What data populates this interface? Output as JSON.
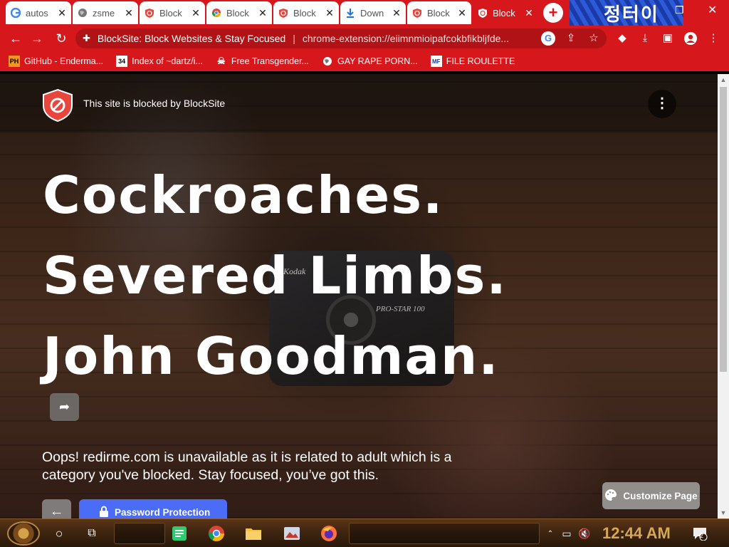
{
  "tabs": [
    {
      "title": "autos",
      "icon": "google-icon",
      "active": false
    },
    {
      "title": "zsme",
      "icon": "globe-icon",
      "active": false
    },
    {
      "title": "Block",
      "icon": "blocksite-shield-icon",
      "active": false
    },
    {
      "title": "Block",
      "icon": "chrome-icon",
      "active": false
    },
    {
      "title": "Block",
      "icon": "blocksite-shield-icon",
      "active": false
    },
    {
      "title": "Down",
      "icon": "download-icon",
      "active": false
    },
    {
      "title": "Block",
      "icon": "blocksite-shield-icon",
      "active": false
    },
    {
      "title": "Block",
      "icon": "blocksite-shield-icon",
      "active": true
    }
  ],
  "omnibox": {
    "page_title": "BlockSite: Block Websites & Stay Focused",
    "url": "chrome-extension://eiimnmioipafcokbfikbljfde..."
  },
  "bookmarks": [
    {
      "label": "GitHub - Enderma...",
      "icon": "PH"
    },
    {
      "label": "Index of ~dartz/i...",
      "icon": "34"
    },
    {
      "label": "Free Transgender...",
      "icon": "skull-icon"
    },
    {
      "label": "GAY RAPE PORN...",
      "icon": "globe-icon"
    },
    {
      "label": "FILE ROULETTE",
      "icon": "MF"
    }
  ],
  "banner_text": "정터이",
  "page": {
    "blocked_by": "This site is blocked by BlockSite",
    "headlines": [
      "Cockroaches.",
      "Severed Limbs.",
      "John Goodman."
    ],
    "message": "Oops! redirme.com is unavailable as it is related to adult which is a category you've blocked. Stay focused, you’ve got this.",
    "password_button": "Password Protection",
    "customize_button": "Customize Page",
    "camera_brand": "Kodak",
    "camera_model": "PRO-STAR 100"
  },
  "taskbar": {
    "clock": "12:44 AM",
    "notification_count": "2"
  },
  "colors": {
    "chrome_theme": "#d6181c",
    "password_button": "#4a6cf7",
    "blocksite_red": "#e8453c",
    "clock": "#d7a84e"
  }
}
